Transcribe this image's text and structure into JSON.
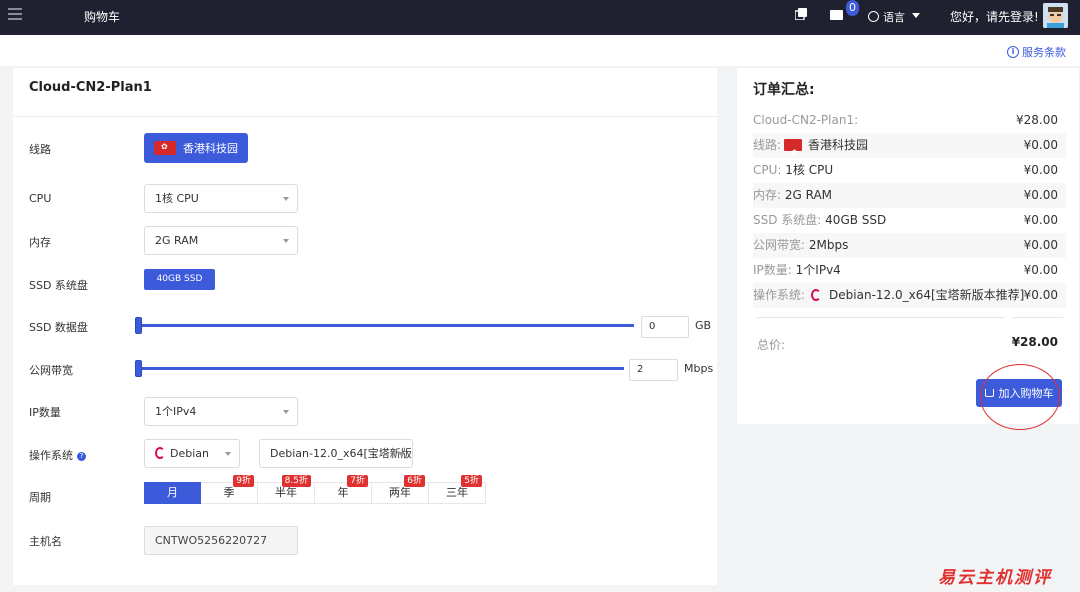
{
  "nav": {
    "title": "购物车",
    "badge": "0",
    "lang": "语言",
    "greeting": "您好，请先登录!"
  },
  "terms_link": "服务条款",
  "config": {
    "plan_title": "Cloud-CN2-Plan1",
    "rows": {
      "route": "线路",
      "cpu": "CPU",
      "memory": "内存",
      "ssd_system": "SSD 系统盘",
      "ssd_data": "SSD 数据盘",
      "bandwidth": "公网带宽",
      "ip_count": "IP数量",
      "os": "操作系统",
      "period": "周期",
      "hostname": "主机名"
    },
    "route_value": "香港科技园",
    "cpu_value": "1核 CPU",
    "memory_value": "2G RAM",
    "ssd_system_value": "40GB SSD",
    "ssd_data_value": "0",
    "ssd_data_unit": "GB",
    "ssd_data_level": 0,
    "bandwidth_value": "2",
    "bandwidth_unit": "Mbps",
    "bandwidth_level": 0,
    "ip_value": "1个IPv4",
    "os_family": "Debian",
    "os_version": "Debian-12.0_x64[宝塔新版",
    "periods": [
      {
        "label": "月",
        "discount": "",
        "active": true
      },
      {
        "label": "季",
        "discount": "9折",
        "active": false
      },
      {
        "label": "半年",
        "discount": "8.5折",
        "active": false
      },
      {
        "label": "年",
        "discount": "7折",
        "active": false
      },
      {
        "label": "两年",
        "discount": "6折",
        "active": false
      },
      {
        "label": "三年",
        "discount": "5折",
        "active": false
      }
    ],
    "hostname_value": "CNTWO5256220727"
  },
  "summary": {
    "title": "订单汇总:",
    "lines": [
      {
        "key": "Cloud-CN2-Plan1:",
        "value": "",
        "price": "¥28.00"
      },
      {
        "key": "线路:",
        "value": "香港科技园",
        "price": "¥0.00"
      },
      {
        "key": "CPU:",
        "value": "1核 CPU",
        "price": "¥0.00"
      },
      {
        "key": "内存:",
        "value": "2G RAM",
        "price": "¥0.00"
      },
      {
        "key": "SSD 系统盘:",
        "value": "40GB SSD",
        "price": "¥0.00"
      },
      {
        "key": "公网带宽:",
        "value": "2Mbps",
        "price": "¥0.00"
      },
      {
        "key": "IP数量:",
        "value": "1个IPv4",
        "price": "¥0.00"
      },
      {
        "key": "操作系统:",
        "value": "Debian-12.0_x64[宝塔新版本推荐]",
        "price": "¥0.00"
      }
    ],
    "total_label": "总价:",
    "total_value": "¥28.00",
    "cart_button": "加入购物车"
  },
  "watermark": "易云主机测评",
  "colors": {
    "accent": "#3b5bdb",
    "nav_bg": "#1f2130",
    "discount": "#e03131"
  }
}
